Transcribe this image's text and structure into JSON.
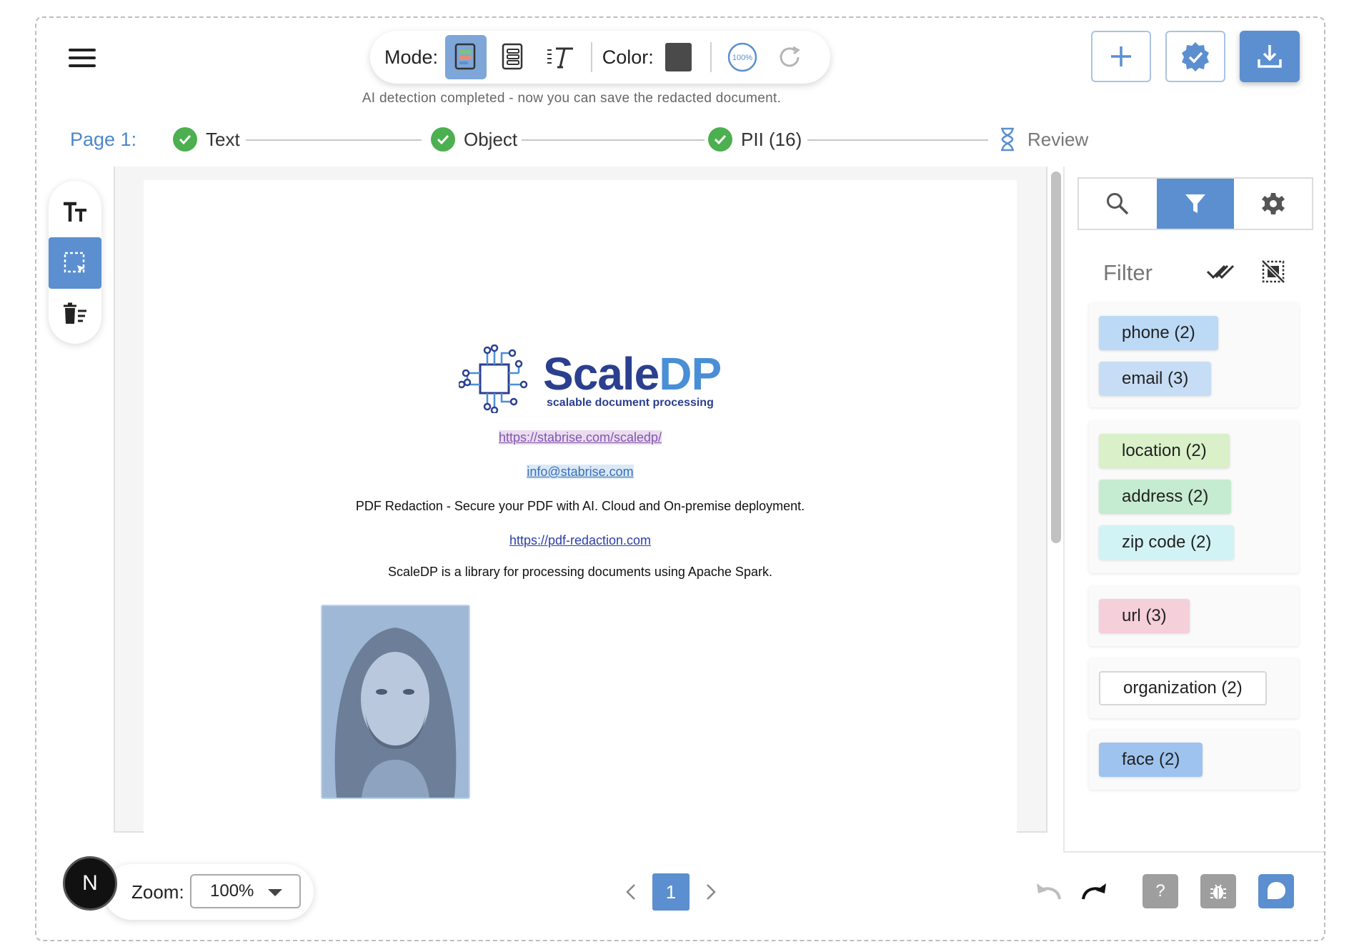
{
  "toolbar": {
    "mode_label": "Mode:",
    "color_label": "Color:",
    "zoom_badge": "100%",
    "color_value": "#4a4a4a",
    "modes": [
      "page-mode-icon",
      "list-mode-icon",
      "text-mode-icon"
    ],
    "active_mode": 0
  },
  "hint": "AI detection completed - now you can save the redacted document.",
  "stepper": {
    "page_label": "Page 1:",
    "steps": [
      {
        "label": "Text",
        "status": "done"
      },
      {
        "label": "Object",
        "status": "done"
      },
      {
        "label": "PII (16)",
        "status": "done"
      },
      {
        "label": "Review",
        "status": "pending"
      }
    ]
  },
  "document": {
    "logo_main": "Scale",
    "logo_accent": "DP",
    "logo_sub": "scalable document processing",
    "lines": [
      "https://stabrise.com/scaledp/",
      "info@stabrise.com",
      "PDF Redaction - Secure your PDF with AI. Cloud and On-premise deployment.",
      "https://pdf-redaction.com",
      "ScaleDP is a library for processing documents using Apache Spark."
    ]
  },
  "sidebar": {
    "filter_title": "Filter",
    "groups": [
      {
        "chips": [
          {
            "label": "phone (2)",
            "color": "#bcd9f5"
          },
          {
            "label": "email (3)",
            "color": "#c7ddf5"
          }
        ]
      },
      {
        "chips": [
          {
            "label": "location (2)",
            "color": "#d9f0c8"
          },
          {
            "label": "address (2)",
            "color": "#c5ecd0"
          },
          {
            "label": "zip code (2)",
            "color": "#d2f3f5"
          }
        ]
      },
      {
        "chips": [
          {
            "label": "url (3)",
            "color": "#f5cfd9"
          }
        ]
      },
      {
        "chips": [
          {
            "label": "organization (2)",
            "color": "#ffffff"
          }
        ]
      },
      {
        "chips": [
          {
            "label": "face (2)",
            "color": "#9ec3ee"
          }
        ]
      }
    ]
  },
  "bottom": {
    "avatar_letter": "N",
    "zoom_label": "Zoom:",
    "zoom_value": "100%",
    "page": "1",
    "help_label": "?"
  },
  "colors": {
    "accent": "#5b8fd0",
    "success": "#4caf50",
    "page_label": "#4d87c9"
  }
}
